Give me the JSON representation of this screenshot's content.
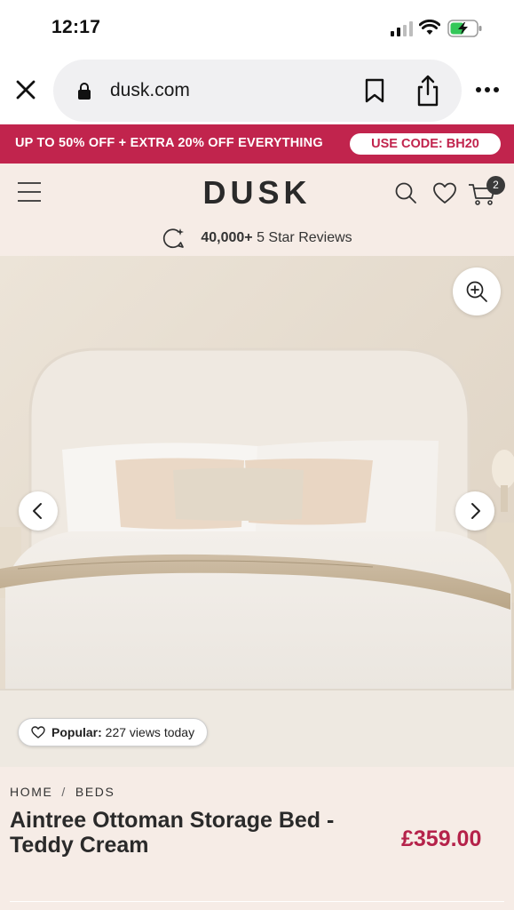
{
  "status_bar": {
    "time": "12:17"
  },
  "browser": {
    "url": "dusk.com",
    "icons": [
      "close-icon",
      "lock-icon",
      "bookmark-icon",
      "share-icon",
      "more-icon"
    ]
  },
  "promo": {
    "text": "UP TO 50% OFF + EXTRA 20% OFF EVERYTHING",
    "code": "USE CODE: BH20",
    "color": "#c1244d"
  },
  "header": {
    "logo": "DUSK",
    "cart_count": "2",
    "reviews_count": "40,000+",
    "reviews_label": "5 Star Reviews",
    "background": "#f6ece6"
  },
  "gallery": {
    "popular_label": "Popular:",
    "popular_text": "227 views today"
  },
  "product": {
    "breadcrumb": [
      "HOME",
      "BEDS"
    ],
    "breadcrumb_sep": "/",
    "title": "Aintree Ottoman Storage Bed - Teddy Cream",
    "price": "£359.00",
    "price_color": "#b5224a"
  }
}
